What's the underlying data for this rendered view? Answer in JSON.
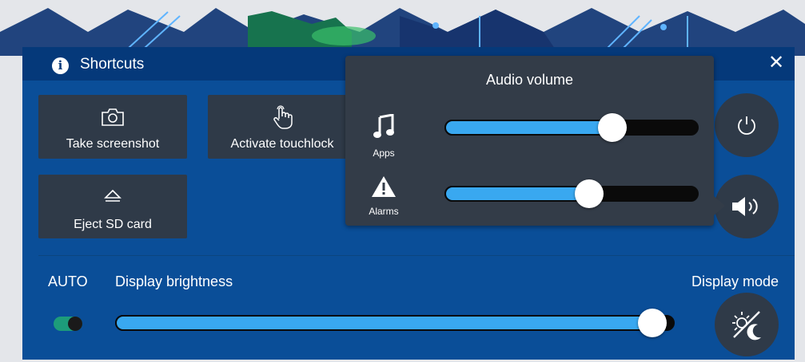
{
  "shortcuts": {
    "title": "Shortcuts",
    "take_screenshot": "Take screenshot",
    "activate_touchlock": "Activate touchlock",
    "eject_sd_card": "Eject SD card"
  },
  "brightness": {
    "auto_label": "AUTO",
    "label": "Display brightness",
    "auto_enabled": true,
    "level_percent": 96
  },
  "display_mode": {
    "label": "Display mode"
  },
  "audio": {
    "title": "Audio volume",
    "apps_label": "Apps",
    "alarms_label": "Alarms",
    "apps_level_percent": 66,
    "alarms_level_percent": 57
  },
  "colors": {
    "panel": "#0a4e98",
    "titlebar": "#05397a",
    "tile": "#2f3a48",
    "slider_fill": "#39a8f0",
    "toggle_on": "#1d9c7a"
  },
  "icons": {
    "info": "info-icon",
    "close": "close-icon",
    "camera": "camera-icon",
    "touch": "touch-hand-icon",
    "eject": "eject-icon",
    "power": "power-icon",
    "speaker": "speaker-icon",
    "music": "music-note-icon",
    "warning": "warning-icon",
    "day_night": "day-night-icon"
  }
}
